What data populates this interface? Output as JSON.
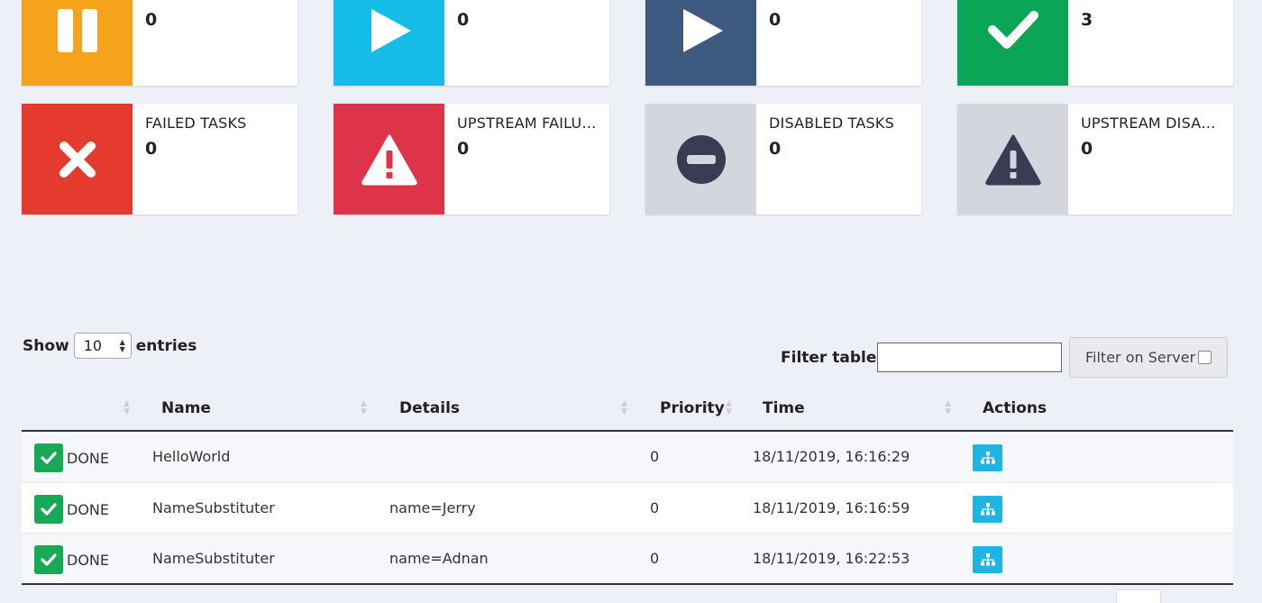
{
  "cards": [
    {
      "label": "",
      "count": "0",
      "color": "#f5a31a",
      "icon": "pause-icon"
    },
    {
      "label": "",
      "count": "0",
      "color": "#16bde8",
      "icon": "play-icon"
    },
    {
      "label": "",
      "count": "0",
      "color": "#3d5a80",
      "icon": "play-icon"
    },
    {
      "label": "",
      "count": "3",
      "color": "#0aa557",
      "icon": "check-icon"
    },
    {
      "label": "FAILED TASKS",
      "count": "0",
      "color": "#e53b2e",
      "icon": "x-icon"
    },
    {
      "label": "UPSTREAM FAILU…",
      "count": "0",
      "color": "#de3449",
      "icon": "warning-icon"
    },
    {
      "label": "DISABLED TASKS",
      "count": "0",
      "color": "#d3d6dc",
      "icon": "minus-circle-icon"
    },
    {
      "label": "UPSTREAM DISA…",
      "count": "0",
      "color": "#d3d6dc",
      "icon": "warning-icon"
    }
  ],
  "controls": {
    "show_label": "Show",
    "entries_value": "10",
    "entries_label": "entries",
    "filter_label": "Filter table:",
    "filter_value": "",
    "filter_server_label": "Filter on Server"
  },
  "table": {
    "headers": {
      "name": "Name",
      "details": "Details",
      "priority": "Priority",
      "time": "Time",
      "actions": "Actions"
    },
    "rows": [
      {
        "status": "DONE",
        "name": "HelloWorld",
        "details": "",
        "priority": "0",
        "time": "18/11/2019, 16:16:29"
      },
      {
        "status": "DONE",
        "name": "NameSubstituter",
        "details": "name=Jerry",
        "priority": "0",
        "time": "18/11/2019, 16:16:59"
      },
      {
        "status": "DONE",
        "name": "NameSubstituter",
        "details": "name=Adnan",
        "priority": "0",
        "time": "18/11/2019, 16:22:53"
      }
    ]
  },
  "colors": {
    "done_green": "#18a957",
    "action_blue": "#20b4e3"
  }
}
